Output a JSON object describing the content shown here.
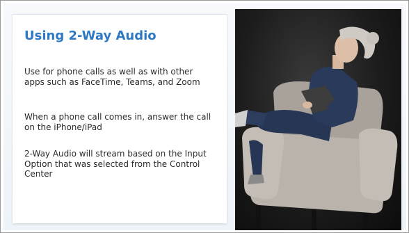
{
  "slide": {
    "title": "Using 2-Way Audio",
    "paragraphs": [
      "Use for phone calls as well as with other apps such as FaceTime, Teams, and Zoom",
      "When a phone call comes in, answer the call on the iPhone/iPad",
      "2-Way Audio will stream based on the Input Option that was selected from the Control Center"
    ]
  },
  "colors": {
    "title": "#2f78c4",
    "body_text": "#2b2b2b",
    "photo_background": "#1c1c1c"
  },
  "photo": {
    "icon": "person-in-armchair-with-tablet-photo"
  }
}
